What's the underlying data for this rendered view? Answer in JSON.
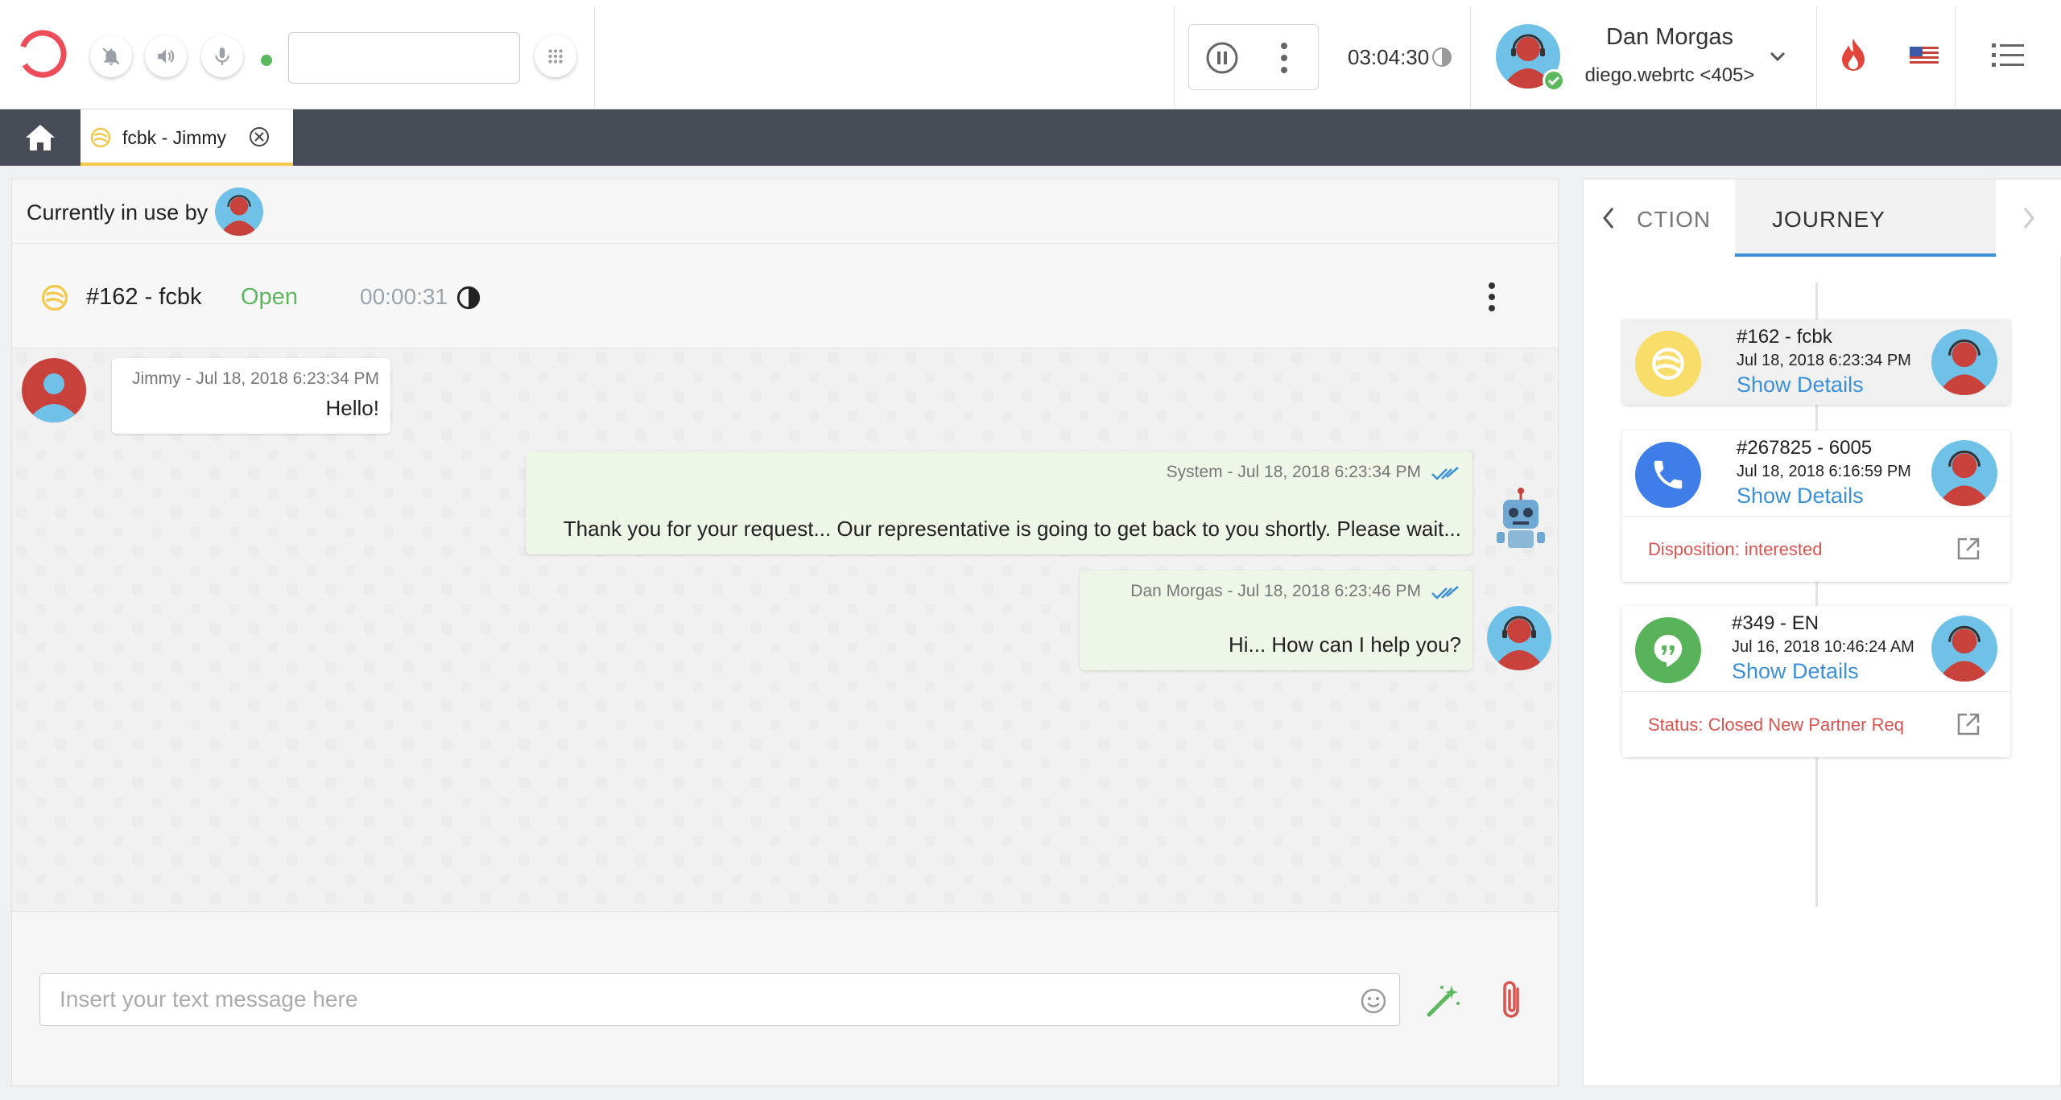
{
  "topbar": {
    "dial_value": "",
    "timer": "03:04:30",
    "user_name": "Dan Morgas",
    "user_extension": "diego.webrtc <405>"
  },
  "tabs": [
    {
      "label": "fcbk - Jimmy"
    }
  ],
  "conversation": {
    "in_use_label": "Currently in use by",
    "ticket_title": "#162 - fcbk",
    "ticket_status": "Open",
    "ticket_timer": "00:00:31",
    "messages": [
      {
        "direction": "in",
        "meta": "Jimmy - Jul 18, 2018 6:23:34 PM",
        "text": "Hello!"
      },
      {
        "direction": "out",
        "meta": "System - Jul 18, 2018 6:23:34 PM",
        "text": "Thank you for your request... Our representative is going to get back to you shortly. Please wait..."
      },
      {
        "direction": "out",
        "meta": "Dan Morgas - Jul 18, 2018 6:23:46 PM",
        "text": "Hi... How can I help you?"
      }
    ],
    "composer_placeholder": "Insert your text message here"
  },
  "side": {
    "tab_prev_label": "CTION",
    "tab_active_label": "JOURNEY",
    "cards": [
      {
        "title": "#162 - fcbk",
        "date": "Jul 18, 2018 6:23:34 PM",
        "link": "Show Details",
        "footer": ""
      },
      {
        "title": "#267825 - 6005",
        "date": "Jul 18, 2018 6:16:59 PM",
        "link": "Show Details",
        "footer": "Disposition: interested"
      },
      {
        "title": "#349 - EN",
        "date": "Jul 16, 2018 10:46:24 AM",
        "link": "Show Details",
        "footer": "Status: Closed New Partner Req"
      }
    ]
  },
  "colors": {
    "accent_blue": "#3a8fd9",
    "open_green": "#5cb85c",
    "alert_red": "#d9534f",
    "tab_yellow": "#f2c94c",
    "tabbar_bg": "#474b55"
  },
  "icons": [
    "logo-icon",
    "bell-off-icon",
    "volume-icon",
    "mic-icon",
    "dialpad-icon",
    "pause-icon",
    "more-vert-icon",
    "timer-icon",
    "chevron-down-icon",
    "fire-icon",
    "us-flag-icon",
    "list-menu-icon",
    "home-icon",
    "facebook-icon",
    "close-circle-icon",
    "robot-icon",
    "double-check-icon",
    "emoji-icon",
    "magic-wand-icon",
    "paperclip-icon",
    "chevron-left-icon",
    "chevron-right-icon",
    "phone-icon",
    "hangouts-icon",
    "open-external-icon"
  ]
}
